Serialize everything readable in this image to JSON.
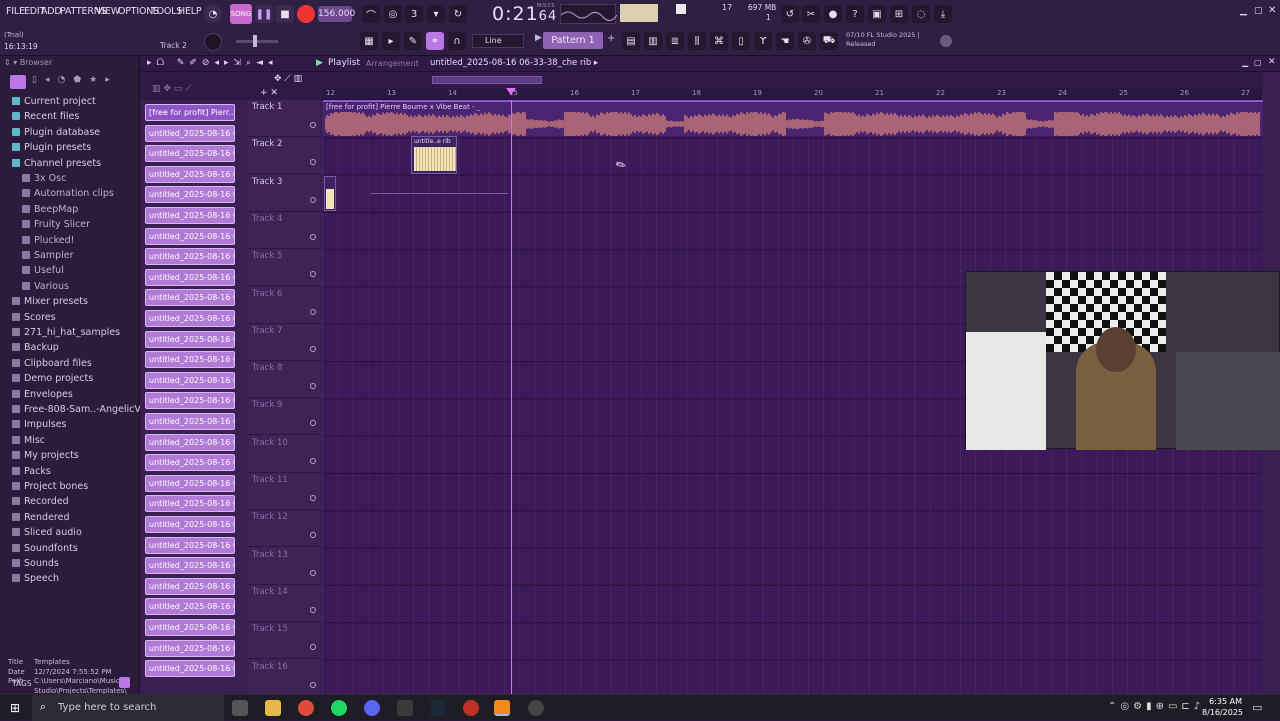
{
  "menu": {
    "items": [
      "FILE",
      "EDIT",
      "ADD",
      "PATTERNS",
      "VIEW",
      "OPTIONS",
      "TOOLS",
      "HELP"
    ]
  },
  "transport": {
    "tempo": "156.000",
    "time": "0:21",
    "time_frac": "64",
    "time_unit": "M:S:CS",
    "cpu": "17",
    "memory": "697 MB",
    "poly": "1"
  },
  "hint": {
    "mode": "(Trial)",
    "clock": "16:13:19",
    "focus": "Track 2"
  },
  "toolbar": {
    "snap": "Line",
    "pattern": "Pattern 1",
    "news": "07/10 FL Studio 2025 | Released"
  },
  "browser": {
    "title": "Browser",
    "items": [
      {
        "label": "Current project",
        "sub": false
      },
      {
        "label": "Recent files",
        "sub": false
      },
      {
        "label": "Plugin database",
        "sub": false
      },
      {
        "label": "Plugin presets",
        "sub": false
      },
      {
        "label": "Channel presets",
        "sub": false
      },
      {
        "label": "3x Osc",
        "sub": true
      },
      {
        "label": "Automation clips",
        "sub": true
      },
      {
        "label": "BeepMap",
        "sub": true
      },
      {
        "label": "Fruity Slicer",
        "sub": true
      },
      {
        "label": "Plucked!",
        "sub": true
      },
      {
        "label": "Sampler",
        "sub": true
      },
      {
        "label": "Useful",
        "sub": true
      },
      {
        "label": "Various",
        "sub": true
      },
      {
        "label": "Mixer presets",
        "sub": false
      },
      {
        "label": "Scores",
        "sub": false
      },
      {
        "label": "271_hi_hat_samples",
        "sub": false
      },
      {
        "label": "Backup",
        "sub": false
      },
      {
        "label": "Clipboard files",
        "sub": false
      },
      {
        "label": "Demo projects",
        "sub": false
      },
      {
        "label": "Envelopes",
        "sub": false
      },
      {
        "label": "Free-808-Sam..-AngelicVibes",
        "sub": false
      },
      {
        "label": "Impulses",
        "sub": false
      },
      {
        "label": "Misc",
        "sub": false
      },
      {
        "label": "My projects",
        "sub": false
      },
      {
        "label": "Packs",
        "sub": false
      },
      {
        "label": "Project bones",
        "sub": false
      },
      {
        "label": "Recorded",
        "sub": false
      },
      {
        "label": "Rendered",
        "sub": false
      },
      {
        "label": "Sliced audio",
        "sub": false
      },
      {
        "label": "Soundfonts",
        "sub": false
      },
      {
        "label": "Sounds",
        "sub": false
      },
      {
        "label": "Speech",
        "sub": false
      }
    ],
    "info": {
      "title_label": "Title",
      "title_value": "Templates",
      "date_label": "Date",
      "date_value": "12/7/2024 7:55:52 PM",
      "path_label": "Path",
      "path_value": "C:\\Users\\Marciano\\Music\\FL Studio\\Projects\\Templates\\"
    },
    "tags": "TAGS"
  },
  "playlist": {
    "title": "Playlist",
    "section": "Arrangement",
    "project": "untitled_2025-08-16 06-33-38_che rib",
    "patterns": [
      "[free for profit] Pierr...",
      "untitled_2025-08-16 06-...",
      "untitled_2025-08-16 06-...",
      "untitled_2025-08-16 06-...",
      "untitled_2025-08-16 06-...",
      "untitled_2025-08-16 06-...",
      "untitled_2025-08-16 06-...",
      "untitled_2025-08-16 06-...",
      "untitled_2025-08-16 06-...",
      "untitled_2025-08-16 06-...",
      "untitled_2025-08-16 06-...",
      "untitled_2025-08-16 06-...",
      "untitled_2025-08-16 06-...",
      "untitled_2025-08-16 06-...",
      "untitled_2025-08-16 06-...",
      "untitled_2025-08-16 06-...",
      "untitled_2025-08-16 06-...",
      "untitled_2025-08-16 06-...",
      "untitled_2025-08-16 06-...",
      "untitled_2025-08-16 06-...",
      "untitled_2025-08-16 06-...",
      "untitled_2025-08-16 06-...",
      "untitled_2025-08-16 06-...",
      "untitled_2025-08-16 06-...",
      "untitled_2025-08-16 06-...",
      "untitled_2025-08-16 06-...",
      "untitled_2025-08-16 06-...",
      "untitled_2025-08-16 06-..."
    ],
    "tracks": [
      "Track 1",
      "Track 2",
      "Track 3",
      "Track 4",
      "Track 5",
      "Track 6",
      "Track 7",
      "Track 8",
      "Track 9",
      "Track 10",
      "Track 11",
      "Track 12",
      "Track 13",
      "Track 14",
      "Track 15",
      "Track 16"
    ],
    "bars": [
      "12",
      "13",
      "14",
      "15",
      "16",
      "17",
      "18",
      "19",
      "20",
      "21",
      "22",
      "23",
      "24",
      "25",
      "26",
      "27"
    ],
    "audio_clip": "[free for profit] Pierre Bourne x Vibe Beat - _",
    "pattern_clip": "untitle..e rib"
  },
  "taskbar": {
    "search": "Type here to search",
    "time": "6:35 AM",
    "date": "8/16/2025"
  },
  "colors": {
    "accent": "#b07ad6",
    "wave": "#e8907a",
    "playhead": "#d870ff"
  }
}
